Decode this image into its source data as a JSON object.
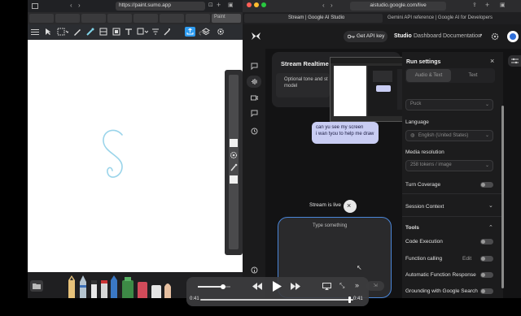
{
  "left_browser": {
    "url": "https://paint.sumo.app",
    "tab_paint": "Paint"
  },
  "right_browser": {
    "url": "aistudio.google.com/live",
    "tab_stream": "Stream | Google AI Studio",
    "tab_gemini": "Gemini API reference | Google AI for Developers"
  },
  "header": {
    "get_api_key": "Get API key",
    "studio": "Studio",
    "dashboard": "Dashboard",
    "documentation": "Documentation"
  },
  "stream": {
    "title": "Stream Realtime",
    "description": "Optional tone and st model",
    "chat_line1": "can yu see my screen",
    "chat_line2": "i wan tyou to help me draw",
    "live_label": "Stream is live",
    "composer_placeholder": "Type something"
  },
  "run_settings": {
    "title": "Run settings",
    "tab_audio": "Audio & Text",
    "tab_text": "Text",
    "voice_value": "Puck",
    "language_label": "Language",
    "language_value": "English (United States)",
    "media_label": "Media resolution",
    "media_value": "258 tokens / image",
    "turn_coverage": "Turn Coverage",
    "session_context": "Session Context",
    "tools": "Tools",
    "code_execution": "Code Execution",
    "function_calling": "Function calling",
    "function_edit": "Edit",
    "auto_function": "Automatic Function Response",
    "grounding": "Grounding with Google Search"
  },
  "player": {
    "time_current": "0:41",
    "time_remaining": "0:41",
    "progress": 0.97,
    "volume": 0.75
  },
  "colors": {
    "accent_blue": "#4a86d9",
    "bubble": "#c9cdf3",
    "stroke_cyan": "#9ad4ea"
  }
}
